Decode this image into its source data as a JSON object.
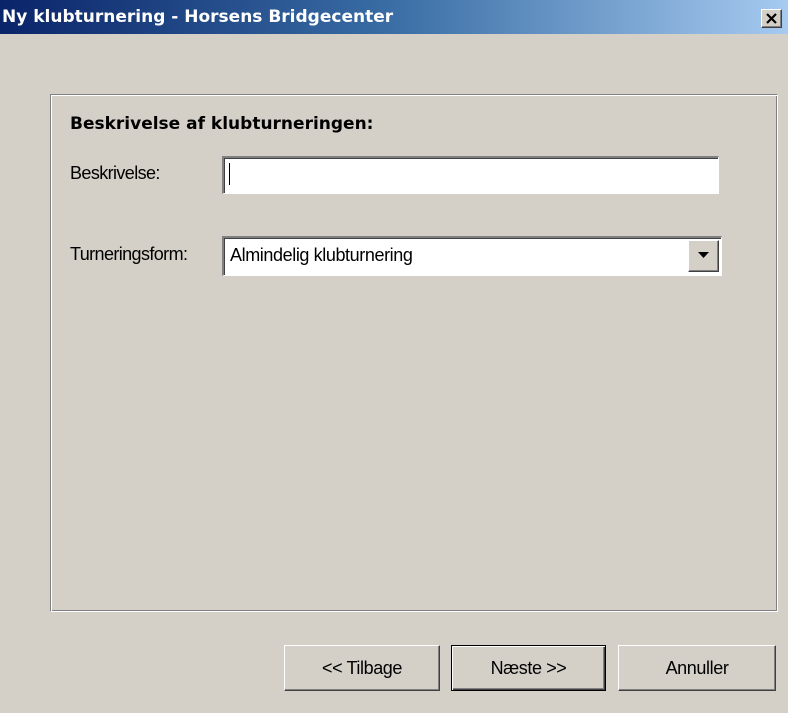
{
  "window": {
    "title": "Ny klubturnering - Horsens Bridgecenter",
    "close_icon": "close-x-icon"
  },
  "group": {
    "heading": "Beskrivelse af klubturneringen:"
  },
  "fields": {
    "description_label": "Beskrivelse:",
    "description_value": "",
    "form_label": "Turneringsform:",
    "form_selected": "Almindelig klubturnering",
    "dropdown_icon": "chevron-down-icon"
  },
  "buttons": {
    "back": "<< Tilbage",
    "next": "Næste >>",
    "cancel": "Annuller"
  }
}
